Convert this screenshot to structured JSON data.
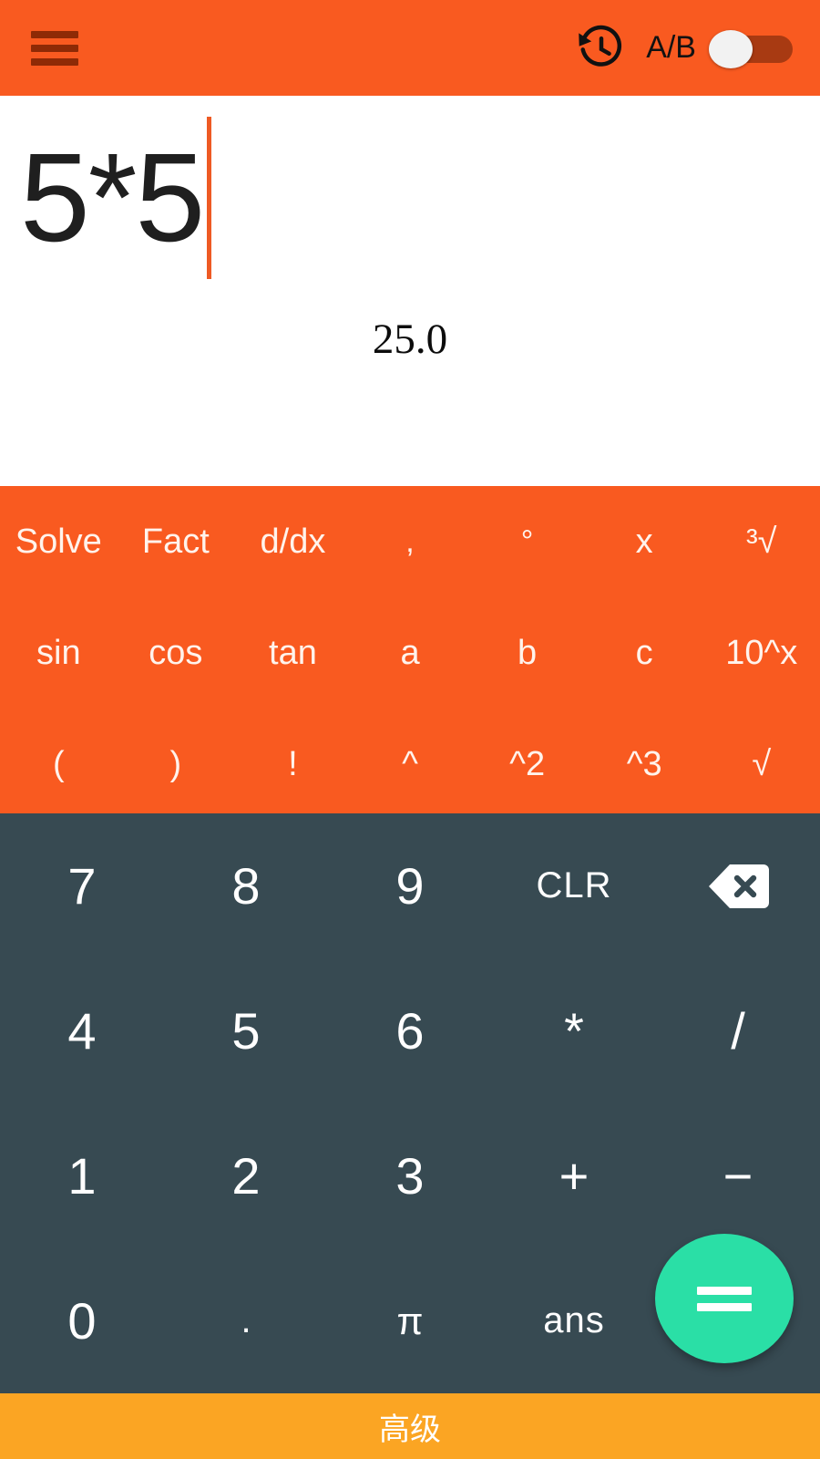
{
  "appbar": {
    "menu_icon": "hamburger-menu-icon",
    "history_icon": "history-restore-icon",
    "ab_label": "A/B",
    "toggle_state": "off"
  },
  "display": {
    "expression": "5*5",
    "result": "25.0",
    "caret_color": "#EE5A24"
  },
  "function_pad": {
    "rows": [
      [
        {
          "label": "Solve",
          "name": "solve"
        },
        {
          "label": "Fact",
          "name": "fact"
        },
        {
          "label": "d/dx",
          "name": "ddx"
        },
        {
          "label": ",",
          "name": "comma"
        },
        {
          "label": "°",
          "name": "degree"
        },
        {
          "label": "x",
          "name": "variable-x"
        },
        {
          "label": "³√",
          "name": "cube-root"
        }
      ],
      [
        {
          "label": "sin",
          "name": "sin"
        },
        {
          "label": "cos",
          "name": "cos"
        },
        {
          "label": "tan",
          "name": "tan"
        },
        {
          "label": "a",
          "name": "variable-a"
        },
        {
          "label": "b",
          "name": "variable-b"
        },
        {
          "label": "c",
          "name": "variable-c"
        },
        {
          "label": "10^x",
          "name": "ten-power-x"
        }
      ],
      [
        {
          "label": "(",
          "name": "left-paren"
        },
        {
          "label": ")",
          "name": "right-paren"
        },
        {
          "label": "!",
          "name": "factorial"
        },
        {
          "label": "^",
          "name": "power"
        },
        {
          "label": "^2",
          "name": "square"
        },
        {
          "label": "^3",
          "name": "cube"
        },
        {
          "label": "√",
          "name": "square-root"
        }
      ]
    ]
  },
  "number_pad": {
    "rows": [
      [
        {
          "label": "7",
          "name": "digit-7"
        },
        {
          "label": "8",
          "name": "digit-8"
        },
        {
          "label": "9",
          "name": "digit-9"
        },
        {
          "label": "CLR",
          "name": "clear"
        },
        {
          "label": "",
          "name": "backspace"
        }
      ],
      [
        {
          "label": "4",
          "name": "digit-4"
        },
        {
          "label": "5",
          "name": "digit-5"
        },
        {
          "label": "6",
          "name": "digit-6"
        },
        {
          "label": "*",
          "name": "multiply"
        },
        {
          "label": "/",
          "name": "divide"
        }
      ],
      [
        {
          "label": "1",
          "name": "digit-1"
        },
        {
          "label": "2",
          "name": "digit-2"
        },
        {
          "label": "3",
          "name": "digit-3"
        },
        {
          "label": "+",
          "name": "plus"
        },
        {
          "label": "−",
          "name": "minus"
        }
      ],
      [
        {
          "label": "0",
          "name": "digit-0"
        },
        {
          "label": ".",
          "name": "decimal-point"
        },
        {
          "label": "π",
          "name": "pi"
        },
        {
          "label": "ans",
          "name": "answer"
        },
        {
          "label": "",
          "name": "equals-slot"
        }
      ]
    ]
  },
  "equals_button": {
    "icon": "equals-icon",
    "color": "#2ADFA6"
  },
  "bottom_bar": {
    "label": "高级",
    "color": "#FBA523"
  },
  "colors": {
    "primary_orange": "#F95A20",
    "dark_keypad": "#374A52",
    "accent_green": "#2ADFA6",
    "amber": "#FBA523",
    "menu_icon": "#8E2A06"
  }
}
